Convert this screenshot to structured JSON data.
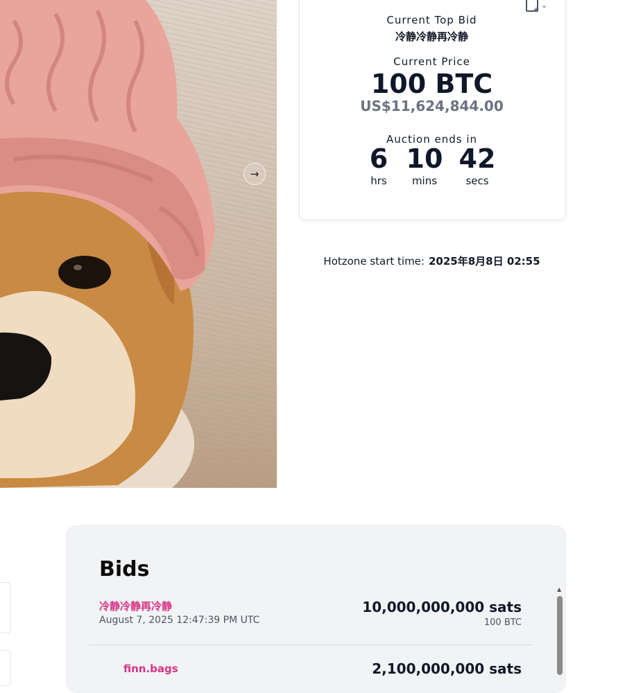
{
  "auction": {
    "top_bid_label": "Current Top Bid",
    "top_bidder": "冷静冷静再冷静",
    "price_label": "Current Price",
    "price": "100 BTC",
    "price_usd": "US$11,624,844.00",
    "ends_label": "Auction ends in",
    "countdown": [
      {
        "value": "6",
        "unit": "hrs"
      },
      {
        "value": "10",
        "unit": "mins"
      },
      {
        "value": "42",
        "unit": "secs"
      }
    ]
  },
  "hotzone": {
    "label": "Hotzone start time:",
    "value": "2025年8月8日 02:55"
  },
  "bids": {
    "title": "Bids",
    "items": [
      {
        "bidder": "冷静冷静再冷静",
        "time": "August 7, 2025 12:47:39 PM UTC",
        "amount": "10,000,000,000 sats",
        "btc": "100 BTC"
      },
      {
        "bidder": "finn.bags",
        "amount": "2,100,000,000 sats"
      }
    ]
  },
  "icons": {
    "next": "arrow-right-icon",
    "calendar": "calendar-add-icon",
    "dropdown": "chevron-down-icon",
    "scroll_up": "scroll-up-arrow-icon"
  },
  "colors": {
    "bidder": "#d63384",
    "panel_bg": "#f2f3f5"
  }
}
